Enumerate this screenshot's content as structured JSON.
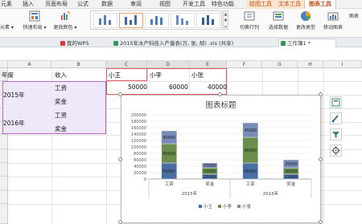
{
  "menu": {
    "tabs": [
      "元素",
      "插入",
      "页面布局",
      "公式",
      "数据",
      "审阅",
      "视图",
      "开发工具",
      "特色功能"
    ],
    "context_tabs": [
      "绘图工具",
      "文本工具"
    ],
    "active_tab": "图表工具"
  },
  "ribbon": {
    "add_element": "元素 ▾",
    "quick_layout": "快速布局 ▾",
    "change_color": "更改颜色 ▾",
    "switch_row_col": "切换行列",
    "select_data": "选择数据",
    "change_type": "更改类型",
    "move_chart": "移动图表",
    "chart_label": "图表"
  },
  "doc_tabs": {
    "my_wps": "我的WPS",
    "file1": "2015年水产科技入产量表(万, 张, 胡) .xls (共享)",
    "workbook": "工作簿1 *"
  },
  "colors": {
    "accent": "#c0501a",
    "selection_purple": "#b067c8",
    "series": [
      "#4a6fa5",
      "#6b8e4e",
      "#7a8bb8"
    ]
  },
  "sheet": {
    "columns": [
      "A",
      "B",
      "C",
      "D",
      "E",
      "F",
      "G",
      "H",
      "I"
    ],
    "header_row": {
      "a": "年度",
      "b": "收入",
      "c": "小王",
      "d": "小李",
      "e": "小张"
    },
    "year1": "2015年",
    "year2": "2016年",
    "wage": "工资",
    "bonus": "奖金",
    "wage2": "工资",
    "bonus2": "奖金",
    "row3": {
      "c": "50000",
      "d": "60000",
      "e": "40000"
    }
  },
  "chart_data": {
    "type": "bar",
    "title": "图表标题",
    "stacked": true,
    "ylim": [
      0,
      200000
    ],
    "yticks": [
      "0",
      "20000",
      "40000",
      "60000",
      "80000",
      "100000",
      "120000",
      "140000",
      "160000",
      "180000",
      "200000"
    ],
    "categories": [
      "工资",
      "奖金",
      "工资",
      "奖金"
    ],
    "groups": [
      "2015年",
      "2016年"
    ],
    "series": [
      {
        "name": "小王",
        "values": [
          50000,
          15000,
          50000,
          15000
        ],
        "labels": [
          "50000",
          "15000",
          "50000",
          "15000"
        ]
      },
      {
        "name": "小李",
        "values": [
          60000,
          20000,
          80000,
          20000
        ],
        "labels": [
          "60000",
          "20000",
          "80000",
          "20000"
        ]
      },
      {
        "name": "小张",
        "values": [
          40000,
          15000,
          45000,
          25000
        ],
        "labels": [
          "40000",
          "15000",
          "45000",
          "25000"
        ]
      }
    ],
    "legend": [
      "小王",
      "小李",
      "小张"
    ],
    "legend_position": "bottom"
  }
}
